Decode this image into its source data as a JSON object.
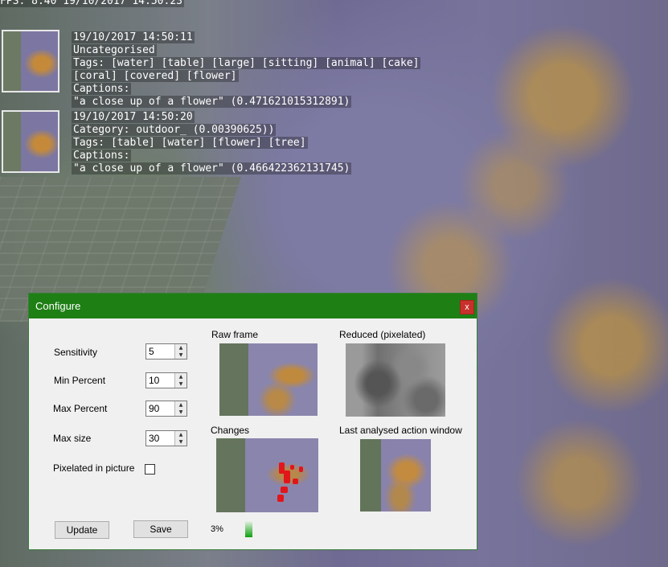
{
  "overlay": {
    "fps_line": "FPS: 8.40 19/10/2017 14:50:23",
    "entries": [
      {
        "timestamp": "19/10/2017 14:50:11",
        "category": "Uncategorised",
        "tags_line1": "Tags: [water] [table] [large] [sitting] [animal] [cake]",
        "tags_line2": "[coral] [covered] [flower]",
        "captions_label": "Captions:",
        "caption": "\"a close up of a flower\" (0.471621015312891)"
      },
      {
        "timestamp": "19/10/2017 14:50:20",
        "category": "Category: outdoor_ (0.00390625))",
        "tags_line1": "Tags: [table] [water] [flower] [tree]",
        "captions_label": "Captions:",
        "caption": "\"a close up of a flower\" (0.466422362131745)"
      }
    ]
  },
  "dialog": {
    "title": "Configure",
    "close_label": "x",
    "fields": {
      "sensitivity": {
        "label": "Sensitivity",
        "value": "5"
      },
      "min_percent": {
        "label": "Min Percent",
        "value": "10"
      },
      "max_percent": {
        "label": "Max Percent",
        "value": "90"
      },
      "max_size": {
        "label": "Max size",
        "value": "30"
      }
    },
    "pixelated_label": "Pixelated in picture",
    "pixelated_checked": false,
    "panels": {
      "raw": "Raw frame",
      "reduced": "Reduced (pixelated)",
      "changes": "Changes",
      "last": "Last analysed action window"
    },
    "buttons": {
      "update": "Update",
      "save": "Save"
    },
    "progress_text": "3%",
    "progress_value": 0.03
  },
  "colors": {
    "titlebar": "#1e7f14",
    "close": "#c8312b",
    "change_marks": "#e0161a"
  }
}
